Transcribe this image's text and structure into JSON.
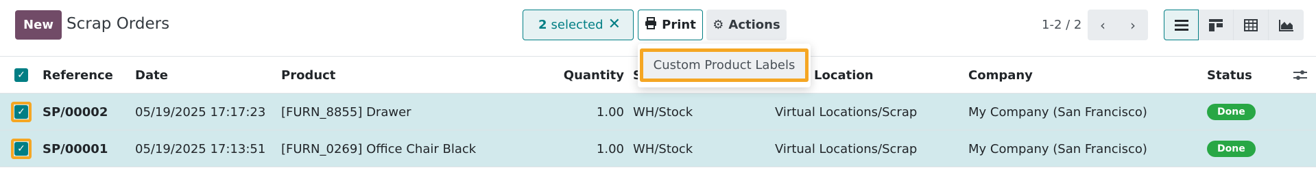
{
  "control_panel": {
    "new_label": "New",
    "title": "Scrap Orders",
    "selected_count": "2",
    "selected_label": "selected",
    "print_label": "Print",
    "actions_label": "Actions",
    "pager": "1-2 / 2"
  },
  "icons": {
    "clear": "close-icon",
    "print": "printer-icon",
    "actions": "gear-icon",
    "prev": "chevron-left-icon",
    "next": "chevron-right-icon",
    "views": [
      "list-view-icon",
      "kanban-view-icon",
      "pivot-view-icon",
      "graph-view-icon"
    ],
    "optional_columns": "sliders-icon"
  },
  "columns": {
    "reference": "Reference",
    "date": "Date",
    "product": "Product",
    "quantity": "Quantity",
    "source_location": "S",
    "scrap_location": "Location",
    "company": "Company",
    "status": "Status"
  },
  "rows": [
    {
      "reference": "SP/00002",
      "date": "05/19/2025 17:17:23",
      "product": "[FURN_8855] Drawer",
      "quantity": "1.00",
      "source_location": "WH/Stock",
      "scrap_location": "Virtual Locations/Scrap",
      "company": "My Company (San Francisco)",
      "status": "Done"
    },
    {
      "reference": "SP/00001",
      "date": "05/19/2025 17:13:51",
      "product": "[FURN_0269] Office Chair Black",
      "quantity": "1.00",
      "source_location": "WH/Stock",
      "scrap_location": "Virtual Locations/Scrap",
      "company": "My Company (San Francisco)",
      "status": "Done"
    }
  ],
  "print_menu": {
    "items": [
      "Custom Product Labels"
    ]
  },
  "colors": {
    "brand": "#714b67",
    "accent": "#017e84",
    "highlight": "#f5a623",
    "selected_row": "#d2e9ec",
    "done_badge": "#28a745"
  }
}
